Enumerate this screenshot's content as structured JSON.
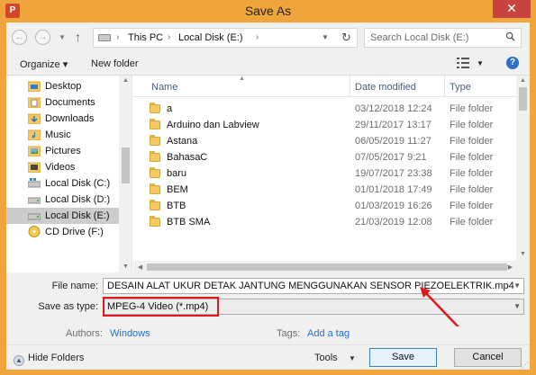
{
  "window": {
    "app_icon": "P",
    "title": "Save As",
    "close_glyph": "✕"
  },
  "nav": {
    "back_glyph": "←",
    "forward_glyph": "→",
    "up_glyph": "↑",
    "breadcrumb": [
      "This PC",
      "Local Disk (E:)"
    ],
    "separator": "›",
    "search_placeholder": "Search Local Disk (E:)"
  },
  "toolbar": {
    "organize_label": "Organize ▾",
    "new_folder_label": "New folder",
    "help_glyph": "?"
  },
  "sidebar": {
    "items": [
      {
        "label": "Desktop",
        "icon": "desktop-folder-icon",
        "selected": false
      },
      {
        "label": "Documents",
        "icon": "documents-folder-icon",
        "selected": false
      },
      {
        "label": "Downloads",
        "icon": "downloads-folder-icon",
        "selected": false
      },
      {
        "label": "Music",
        "icon": "music-folder-icon",
        "selected": false
      },
      {
        "label": "Pictures",
        "icon": "pictures-folder-icon",
        "selected": false
      },
      {
        "label": "Videos",
        "icon": "videos-folder-icon",
        "selected": false
      },
      {
        "label": "Local Disk (C:)",
        "icon": "windows-drive-icon",
        "selected": false
      },
      {
        "label": "Local Disk (D:)",
        "icon": "drive-icon",
        "selected": false
      },
      {
        "label": "Local Disk (E:)",
        "icon": "drive-icon",
        "selected": true
      },
      {
        "label": "CD Drive (F:)",
        "icon": "cd-drive-icon",
        "selected": false
      }
    ]
  },
  "filelist": {
    "columns": {
      "name": "Name",
      "date": "Date modified",
      "type": "Type"
    },
    "rows": [
      {
        "name": "a",
        "date": "03/12/2018 12:24",
        "type": "File folder"
      },
      {
        "name": "Arduino dan Labview",
        "date": "29/11/2017 13:17",
        "type": "File folder"
      },
      {
        "name": "Astana",
        "date": "06/05/2019 11:27",
        "type": "File folder"
      },
      {
        "name": "BahasaC",
        "date": "07/05/2017 9:21",
        "type": "File folder"
      },
      {
        "name": "baru",
        "date": "19/07/2017 23:38",
        "type": "File folder"
      },
      {
        "name": "BEM",
        "date": "01/01/2018 17:49",
        "type": "File folder"
      },
      {
        "name": "BTB",
        "date": "01/03/2019 16:26",
        "type": "File folder"
      },
      {
        "name": "BTB SMA",
        "date": "21/03/2019 12:08",
        "type": "File folder"
      }
    ]
  },
  "form": {
    "filename_label": "File name:",
    "filename_value": "DESAIN ALAT UKUR DETAK JANTUNG MENGGUNAKAN SENSOR PIEZOELEKTRIK.mp4",
    "saveas_label": "Save as type:",
    "saveas_value": "MPEG-4 Video (*.mp4)",
    "authors_label": "Authors:",
    "authors_value": "Windows",
    "tags_label": "Tags:",
    "tags_value": "Add a tag"
  },
  "bottom": {
    "hide_folders_label": "Hide Folders",
    "tools_label": "Tools",
    "save_label": "Save",
    "cancel_label": "Cancel"
  },
  "colors": {
    "title_bar": "#f0a53c",
    "close_button": "#c7443f",
    "highlight_annotation": "#e0191a",
    "link": "#1a6fd0"
  }
}
